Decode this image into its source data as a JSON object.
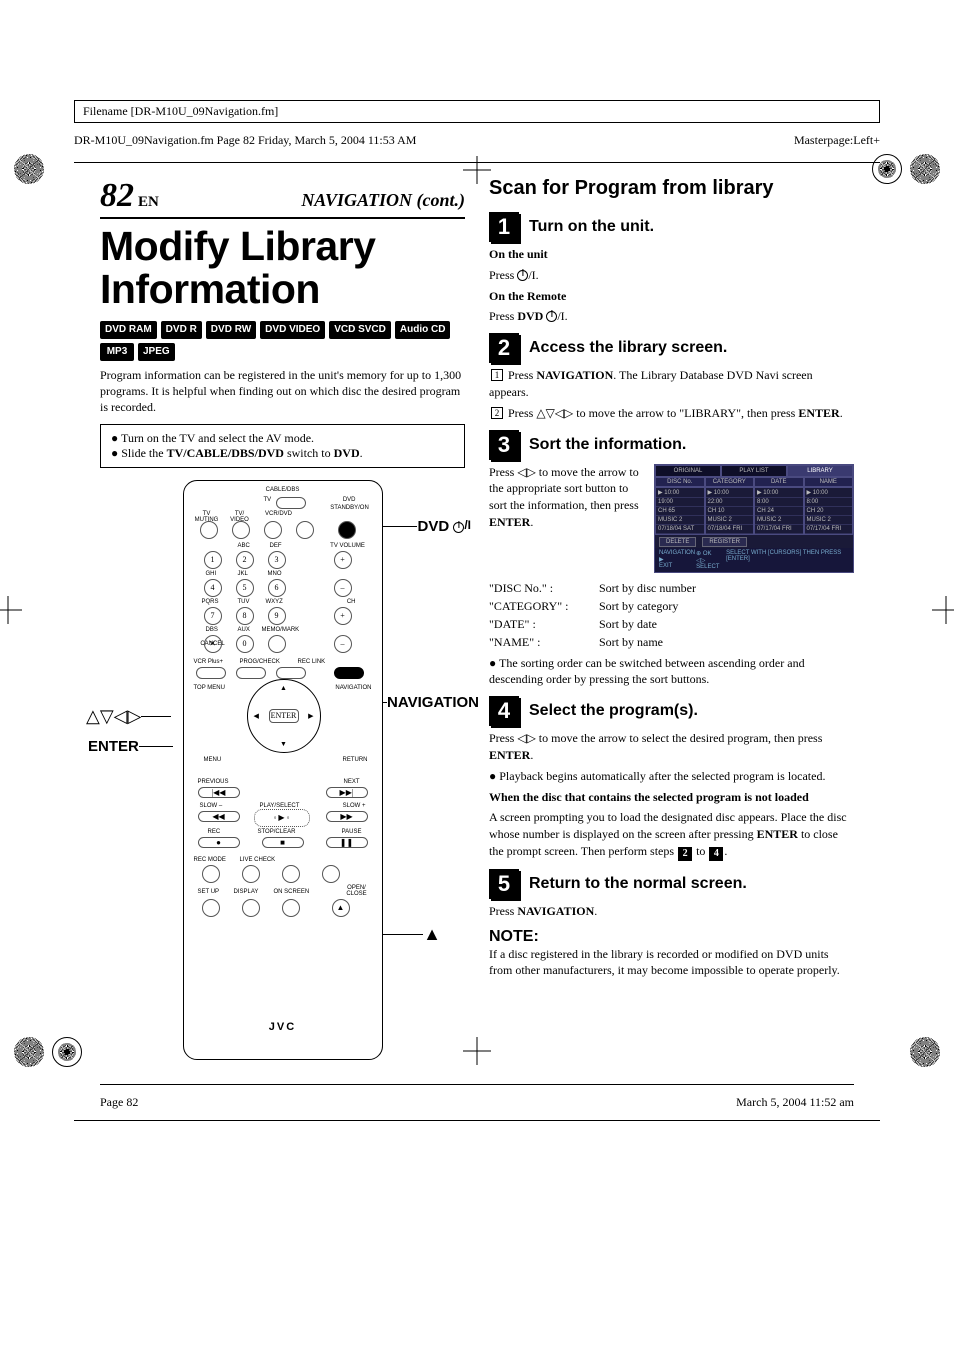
{
  "meta": {
    "filename_label": "Filename [DR-M10U_09Navigation.fm]",
    "running_left": "DR-M10U_09Navigation.fm  Page 82  Friday, March 5, 2004  11:53 AM",
    "running_right": "Masterpage:Left+",
    "page_number": "82",
    "page_lang": "EN",
    "section": "NAVIGATION (cont.)",
    "footer_left": "Page 82",
    "footer_right": "March 5, 2004  11:52 am"
  },
  "left": {
    "title": "Modify Library Information",
    "badges": [
      "DVD RAM",
      "DVD R",
      "DVD RW",
      "DVD VIDEO",
      "VCD SVCD",
      "Audio CD",
      "MP3",
      "JPEG"
    ],
    "intro": "Program information can be registered in the unit's memory for up to 1,300 programs. It is helpful when finding out on which disc the desired program is recorded.",
    "notes": [
      "Turn on the TV and select the AV mode.",
      "Slide the <b>TV/CABLE/DBS/DVD</b> switch to <b>DVD</b>."
    ],
    "callouts": {
      "dvd": "DVD",
      "nav": "NAVIGATION",
      "enter": "ENTER",
      "arrows": "△▽◁▷",
      "power_suffix": "/I"
    },
    "remote_logo": "JVC",
    "remote_labels": {
      "top": "CABLE/DBS",
      "tv": "TV",
      "tv_muting": "TV MUTING",
      "tv_video": "TV/ VIDEO",
      "standby": "STANDBY/ON",
      "vcrdvd": "VCR/DVD",
      "dvd": "DVD",
      "tvvol": "TV VOLUME",
      "ch": "CH",
      "abc": "ABC",
      "def": "DEF",
      "ghi": "GHI",
      "jkl": "JKL",
      "mno": "MNO",
      "pqrs": "PQRS",
      "tuv": "TUV",
      "wxyz": "WXYZ",
      "dbs": "DBS",
      "aux": "AUX",
      "memo": "MEMO/MARK",
      "cancel": "CANCEL",
      "vcrplus": "VCR Plus+",
      "progchk": "PROG/CHECK",
      "reclink": "REC LINK",
      "topmenu": "TOP MENU",
      "navigation": "NAVIGATION",
      "enter": "ENTER",
      "menu": "MENU",
      "return": "RETURN",
      "previous": "PREVIOUS",
      "next": "NEXT",
      "slowm": "SLOW –",
      "playsel": "PLAY/SELECT",
      "slowp": "SLOW +",
      "rec": "REC",
      "stop": "STOP/CLEAR",
      "pause": "PAUSE",
      "recmode": "REC MODE",
      "live": "LIVE CHECK",
      "setup": "SET UP",
      "display": "DISPLAY",
      "onscr": "ON SCREEN",
      "open": "OPEN/ CLOSE"
    }
  },
  "right": {
    "title": "Scan for Program from library",
    "step1": {
      "num": "1",
      "title": "Turn on the unit.",
      "unit_h": "On the unit",
      "unit_t_pre": "Press ",
      "unit_t_post": "/I.",
      "rem_h": "On the Remote",
      "rem_t_pre": "Press ",
      "rem_t_dvd": "DVD",
      "rem_t_post": "/I."
    },
    "step2": {
      "num": "2",
      "title": "Access the library screen.",
      "a_pre": "Press ",
      "a_nav": "NAVIGATION",
      "a_post": ". The Library Database DVD Navi screen appears.",
      "b": "Press △▽◁▷ to move the arrow to \"LIBRARY\", then press ",
      "b_enter": "ENTER",
      "b_dot": "."
    },
    "step3": {
      "num": "3",
      "title": "Sort the information.",
      "text_pre": "Press ◁▷ to move the arrow to the appropriate sort button to sort the information, then press ",
      "text_enter": "ENTER",
      "text_dot": ".",
      "list": [
        {
          "k": "\"DISC No.\" :",
          "v": "Sort by disc number"
        },
        {
          "k": "\"CATEGORY\" :",
          "v": "Sort by category"
        },
        {
          "k": "\"DATE\" :",
          "v": "Sort by date"
        },
        {
          "k": "\"NAME\" :",
          "v": "Sort by name"
        }
      ],
      "bullet": "The sorting order can be switched between ascending order and descending order by pressing the sort buttons."
    },
    "osd": {
      "tabs": [
        "ORIGINAL",
        "PLAY LIST",
        "LIBRARY"
      ],
      "active_tab": 2,
      "headers": [
        "DISC No.",
        "CATEGORY",
        "DATE",
        "NAME"
      ],
      "cols": [
        [
          "▶ 10:00",
          "19:00",
          "CH 65",
          "MUSIC 2",
          "07/18/04 SAT"
        ],
        [
          "▶ 10:00",
          "22:00",
          "CH 10",
          "MUSIC 2",
          "07/18/04 FRI"
        ],
        [
          "▶ 10:00",
          "8:00",
          "CH 24",
          "MUSIC 2",
          "07/17/04 FRI"
        ],
        [
          "▶ 10:00",
          "8:00",
          "CH 20",
          "MUSIC 2",
          "07/17/04 FRI"
        ]
      ],
      "buttons": [
        "DELETE",
        "REGISTER"
      ],
      "hint_left_1": "NAVIGATION",
      "hint_left_2": "EXIT",
      "hint_mid_1": "OK",
      "hint_mid_2": "SELECT",
      "hint_right": "SELECT WITH [CURSORS] THEN PRESS [ENTER]"
    },
    "step4": {
      "num": "4",
      "title": "Select the program(s).",
      "a_pre": "Press ◁▷ to move the arrow to select the desired program, then press ",
      "a_enter": "ENTER",
      "a_dot": ".",
      "b": "Playback begins automatically after the selected program is located.",
      "sub_h": "When the disc that contains the selected program is not loaded",
      "sub_t_pre": "A screen prompting you to load the designated disc appears. Place the disc whose number is displayed on the screen after pressing ",
      "sub_t_enter": "ENTER",
      "sub_t_mid": " to close the prompt screen. Then perform steps ",
      "sub_t_post": "."
    },
    "step5": {
      "num": "5",
      "title": "Return to the normal screen.",
      "a_pre": "Press ",
      "a_nav": "NAVIGATION",
      "a_dot": "."
    },
    "note": {
      "head": "NOTE:",
      "body": "If a disc registered in the library is recorded or modified on DVD units from other manufacturers, it may become impossible to operate properly."
    }
  }
}
